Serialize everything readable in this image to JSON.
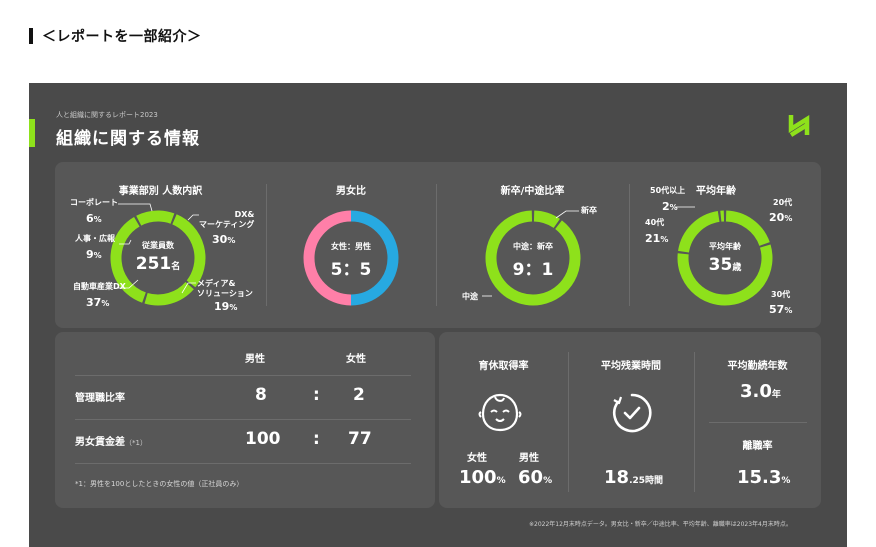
{
  "page_heading": "＜レポートを一部紹介＞",
  "report": {
    "subtitle": "人と組織に関するレポート2023",
    "title": "組織に関する情報",
    "footnote": "※2022年12月末時点データ。男女比・新卒／中途比率、平均年齢、離職率は2023年4月末時点。"
  },
  "colors": {
    "accent": "#8ee11b",
    "female": "#ff7fa8",
    "male": "#27a9e1",
    "panel": "#4a4a4a",
    "card": "#575757"
  },
  "department": {
    "title": "事業部別 人数内訳",
    "center_label": "従業員数",
    "center_value": "251",
    "center_unit": "名",
    "segments": [
      {
        "name": "コーポレート",
        "value": "6",
        "unit": "%"
      },
      {
        "name": "DX&\nマーケティング",
        "value": "30",
        "unit": "%"
      },
      {
        "name": "メディア&\nソリューション",
        "value": "19",
        "unit": "%"
      },
      {
        "name": "自動車産業DX",
        "value": "37",
        "unit": "%"
      },
      {
        "name": "人事・広報",
        "value": "9",
        "unit": "%"
      }
    ],
    "fractions": [
      0.06,
      0.3,
      0.19,
      0.37,
      0.09
    ]
  },
  "gender": {
    "title": "男女比",
    "center_label": "女性：男性",
    "center_value": "5：5",
    "fractions": [
      0.5,
      0.5
    ]
  },
  "hiring": {
    "title": "新卒/中途比率",
    "center_label": "中途：新卒",
    "center_value": "9：1",
    "label_new": "新卒",
    "label_mid": "中途",
    "fractions": [
      0.1,
      0.9
    ]
  },
  "age": {
    "title": "平均年齢",
    "center_label": "平均年齢",
    "center_value": "35",
    "center_unit": "歳",
    "segments": [
      {
        "name": "20代",
        "value": "20",
        "unit": "%"
      },
      {
        "name": "30代",
        "value": "57",
        "unit": "%"
      },
      {
        "name": "40代",
        "value": "21",
        "unit": "%"
      },
      {
        "name": "50代以上",
        "value": "2",
        "unit": "%"
      }
    ],
    "fractions": [
      0.2,
      0.57,
      0.21,
      0.02
    ]
  },
  "table": {
    "col_male": "男性",
    "col_female": "女性",
    "rows": [
      {
        "label": "管理職比率",
        "note": "",
        "male": "8",
        "sep": ":",
        "female": "2"
      },
      {
        "label": "男女賃金差",
        "note": "（*1）",
        "male": "100",
        "sep": ":",
        "female": "77"
      }
    ],
    "footnote": "*1：男性を100としたときの女性の値（正社員のみ）"
  },
  "childcare": {
    "title": "育休取得率",
    "female_label": "女性",
    "male_label": "男性",
    "female_value": "100",
    "male_value": "60",
    "unit": "%"
  },
  "overtime": {
    "title": "平均残業時間",
    "value_int": "18",
    "value_dec": ".25",
    "unit": "時間"
  },
  "tenure": {
    "title": "平均勤続年数",
    "value": "3.0",
    "unit": "年",
    "turnover_title": "離職率",
    "turnover_value": "15.3",
    "turnover_unit": "%"
  }
}
